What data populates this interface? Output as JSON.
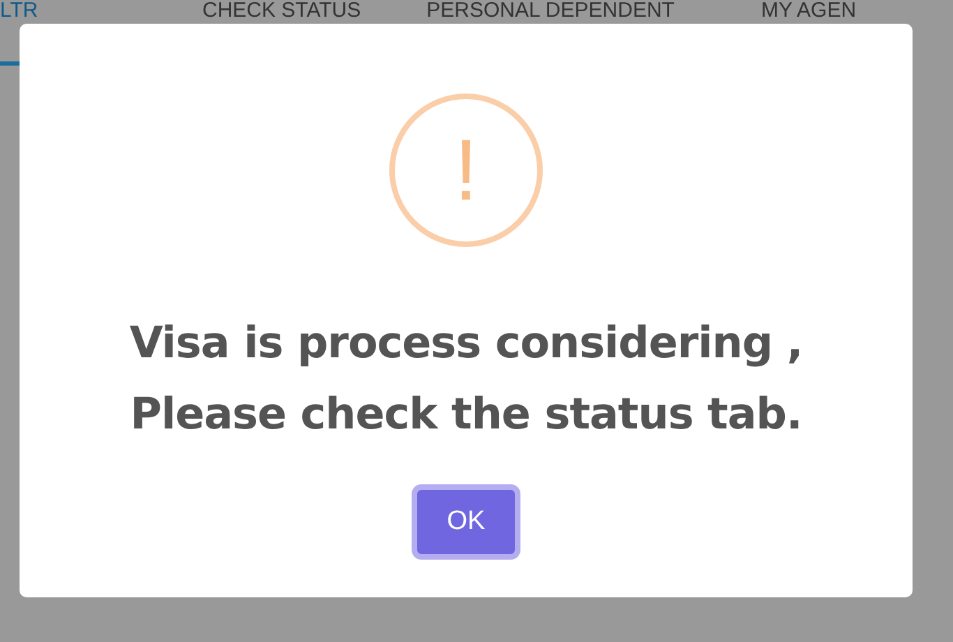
{
  "tabs": [
    {
      "label": "LTR",
      "selected": true
    },
    {
      "label": "CHECK STATUS",
      "selected": false
    },
    {
      "label": "PERSONAL DEPENDENT",
      "selected": false
    },
    {
      "label": "MY AGEN",
      "selected": false
    }
  ],
  "dialog": {
    "icon": "!",
    "message": "Visa is process considering , Please check the status tab.",
    "button": "OK"
  }
}
